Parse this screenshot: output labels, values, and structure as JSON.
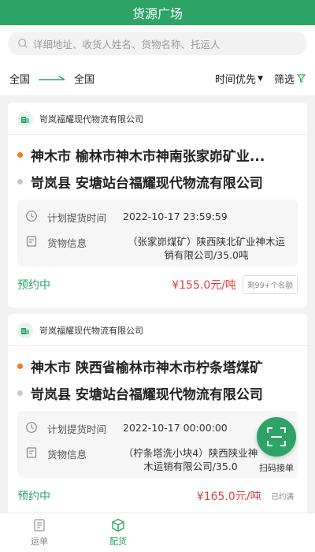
{
  "header": {
    "title": "货源广场"
  },
  "search": {
    "placeholder": "详细地址、收货人姓名、货物名称、托运人"
  },
  "filter": {
    "from": "全国",
    "to": "全国",
    "sort_label": "时间优先",
    "screen_label": "筛选"
  },
  "cards": [
    {
      "company": "岢岚福耀现代物流有限公司",
      "origin": "神木市 榆林市神木市神南张家峁矿业...",
      "destination": "岢岚县 安塘站台福耀现代物流有限公司",
      "pickup_label": "计划提货时间",
      "pickup_time": "2022-10-17 23:59:59",
      "goods_label": "货物信息",
      "goods": "（张家峁煤矿）陕西陕北矿业神木运销有限公司/35.0吨",
      "status": "预约中",
      "price": "¥155.0元/吨",
      "tag": "剩99+个名额"
    },
    {
      "company": "岢岚福耀现代物流有限公司",
      "origin": "神木市 陕西省榆林市神木市柠条塔煤矿",
      "destination": "岢岚县 安塘站台福耀现代物流有限公司",
      "pickup_label": "计划提货时间",
      "pickup_time": "2022-10-17 00:00:00",
      "goods_label": "货物信息",
      "goods": "（柠条塔洗小块4）陕西陕业神木运销有限公司/35.0",
      "status": "预约中",
      "price": "¥165.0元/吨",
      "tag": "已约满"
    }
  ],
  "scan": {
    "label": "扫码接单"
  },
  "tabs": [
    {
      "label": "运单",
      "icon": "waybill-icon"
    },
    {
      "label": "配货",
      "icon": "box-icon",
      "active": true
    }
  ],
  "colors": {
    "brand": "#2ea366",
    "price": "#e0413b",
    "origin_dot": "#f07a2b"
  }
}
